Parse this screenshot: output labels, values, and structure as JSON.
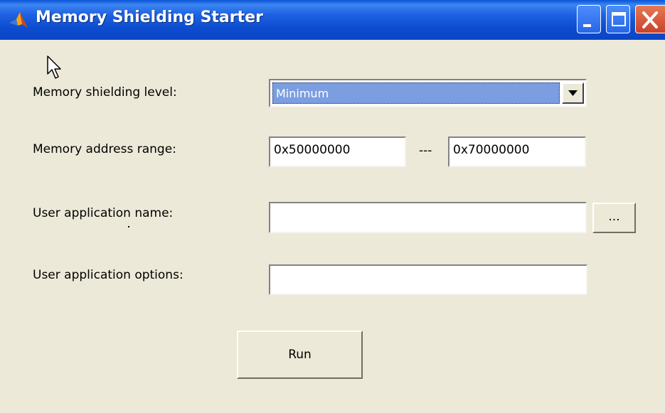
{
  "window": {
    "title": "Memory Shielding Starter",
    "icon": "matlab-icon",
    "controls": [
      "minimize-icon",
      "maximize-icon",
      "close-icon"
    ]
  },
  "form": {
    "shielding_level_label": "Memory shielding level:",
    "shielding_level_value": "Minimum",
    "address_range_label": "Memory address range:",
    "address_start": "0x50000000",
    "address_separator": "---",
    "address_end": "0x70000000",
    "app_name_label": "User application name:",
    "app_name_value": "",
    "browse_label": "...",
    "app_options_label": "User application options:",
    "app_options_value": "",
    "run_label": "Run"
  }
}
